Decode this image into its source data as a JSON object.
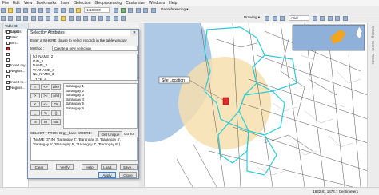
{
  "menu": [
    "File",
    "Edit",
    "View",
    "Bookmarks",
    "Insert",
    "Selection",
    "Geoprocessing",
    "Customize",
    "Windows",
    "Help"
  ],
  "toolbar": {
    "scale": "1:10,000",
    "georeferencing": "Georeferencing ▾",
    "drawing": "Drawing ▾",
    "font": "Arial"
  },
  "toc": {
    "title": "Table Of Contents",
    "rows": [
      "Layers",
      "Main...",
      "Bm...",
      "",
      "",
      "",
      "Insert my...",
      "Negros...",
      "",
      "Insert m...",
      "Negros..."
    ]
  },
  "dialog": {
    "title": "Select by Attributes",
    "close": "✕",
    "prompt": "Enter a WHERE clause to select records in the table window",
    "method_label": "Method :",
    "method_value": "Create a new selection",
    "fields": [
      "fid_NAME_2",
      "GID_3",
      "NAME_3",
      "VARNAME_3",
      "NL_NAME_3",
      "TYPE_3"
    ],
    "operators": [
      [
        "=",
        "<>",
        "Like"
      ],
      [
        ">",
        ">=",
        "And"
      ],
      [
        "<",
        "<=",
        "Or"
      ],
      [
        "_",
        "%",
        "()"
      ],
      [
        "Is",
        "In",
        "Not"
      ]
    ],
    "values": [
      "Barangay 1",
      "Barangay 2",
      "Barangay 3",
      "Barangay 4",
      "Barangay 5",
      "Barangay 6"
    ],
    "get_unique": "Get Unique Values",
    "go_to": "Go To:",
    "sql_label": "SELECT * FROM Brgy_base WHERE:",
    "expression": "\"NAME_3\" IN( 'Barangay 2', 'Barangay 3', 'Barangay 4', 'Barangay 5', 'Barangay 6', 'Barangay 7', 'Barangay 8' )",
    "buttons": {
      "clear": "Clear",
      "verify": "Verify",
      "help": "Help",
      "load": "Load...",
      "save": "Save..."
    },
    "actions": {
      "apply": "Apply",
      "close": "Close"
    }
  },
  "map": {
    "label": "Site Location",
    "colors": {
      "sea": "#aec9e6",
      "buffer": "#f6dfae",
      "highlight": "#29cbd5",
      "site": "#e22a2a",
      "inset_land": "#f2a521",
      "inset_sea": "#8fb0d8"
    }
  },
  "rightpanel": [
    "Catalog",
    "Search",
    "Results"
  ],
  "status": "1632.81 1674.7 Centimeters"
}
